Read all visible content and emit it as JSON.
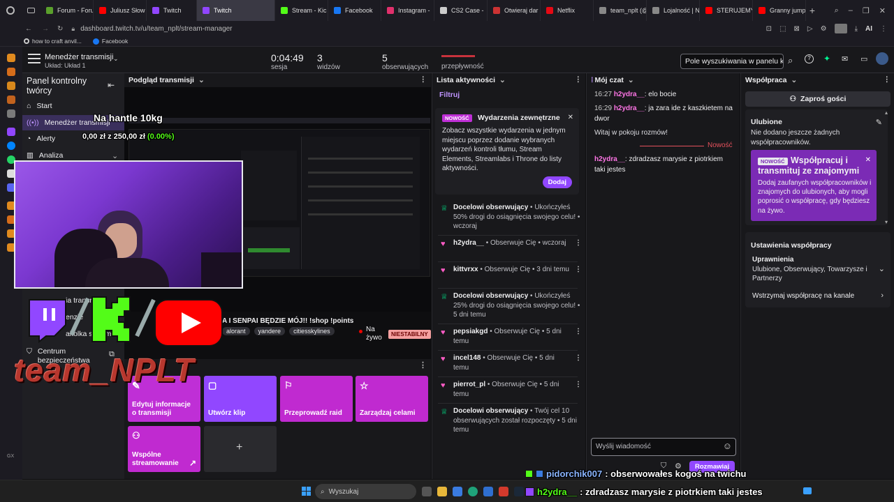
{
  "browser": {
    "tabs": [
      {
        "label": "Forum - Foru",
        "color": "#5aa02c"
      },
      {
        "label": "Juliusz Słow",
        "color": "#ff0000"
      },
      {
        "label": "Twitch",
        "color": "#9146ff"
      },
      {
        "label": "Twitch",
        "color": "#9146ff",
        "active": true
      },
      {
        "label": "Stream - Kic",
        "color": "#53fc18"
      },
      {
        "label": "Facebook",
        "color": "#1877f2"
      },
      {
        "label": "Instagram -",
        "color": "#e1306c"
      },
      {
        "label": "CS2 Case -",
        "color": "#cccccc"
      },
      {
        "label": "Otwieraj dar",
        "color": "#cc3333"
      },
      {
        "label": "Netflix",
        "color": "#e50914"
      },
      {
        "label": "team_nplt (@",
        "color": "#888888"
      },
      {
        "label": "Lojalność | N",
        "color": "#888888"
      },
      {
        "label": "STERUJEMY",
        "color": "#ff0000"
      },
      {
        "label": "Granny jump",
        "color": "#ff0000"
      }
    ],
    "url": "dashboard.twitch.tv/u/team_nplt/stream-manager",
    "url_host_bold": "twitch.tv",
    "bookmarks": [
      "how to craft anvil...",
      "Facebook"
    ],
    "ai_label": "AI"
  },
  "header": {
    "title": "Menedżer transmisji",
    "layout": "Układ: Układ 1",
    "session_value": "0:04:49",
    "session_label": "sesja",
    "viewers_value": "3",
    "viewers_label": "widzów",
    "followers_value": "5",
    "followers_label": "obserwujących",
    "bandwidth_label": "przepływność",
    "search_placeholder": "Pole wyszukiwania w panelu k"
  },
  "left_panel": {
    "title": "Panel kontrolny twórcy",
    "items": [
      "Start",
      "Menedżer transmisji",
      "Alerty",
      "Analiza"
    ],
    "partial_items": [
      "ia transm",
      "enzje",
      "akolka streamer"
    ],
    "safety_center": "Centrum bezpieczeństwa"
  },
  "preview": {
    "title": "Podgląd transmisji",
    "stream_title": "A I SENPAI BĘDZIE MÓJ!! !shop !points",
    "tags": [
      "alorant",
      "yandere",
      "citiesskylines"
    ],
    "live": "Na żywo",
    "unstable": "NIESTABILNY"
  },
  "quick_actions": [
    {
      "label": "Edytuj informacje o transmisji",
      "icon": "edit-icon",
      "color": "#bf2fd6"
    },
    {
      "label": "Utwórz klip",
      "icon": "clip-icon",
      "color": "#9147ff"
    },
    {
      "label": "Przeprowadź raid",
      "icon": "raid-icon",
      "color": "#c02ad0"
    },
    {
      "label": "Zarządzaj celami",
      "icon": "star-icon",
      "color": "#c02ad0"
    },
    {
      "label": "Wspólne streamowanie",
      "icon": "people-icon",
      "color": "#c02ad0"
    }
  ],
  "activity": {
    "title": "Lista aktywności",
    "filter": "Filtruj",
    "notice": {
      "badge": "NOWOŚĆ",
      "title": "Wydarzenia zewnętrzne",
      "body": "Zobacz wszystkie wydarzenia w jednym miejscu poprzez dodanie wybranych wydarzeń kontroli tłumu, Stream Elements, Streamlabs i Throne do listy aktywności.",
      "button": "Dodaj"
    },
    "items": [
      {
        "icon": "trophy",
        "name": "Docelowi obserwujący",
        "text": " • Ukończyłeś 50% drogi do osiągnięcia swojego celu! • wczoraj"
      },
      {
        "icon": "heart",
        "name": "h2ydra__",
        "text": " • Obserwuje Cię • wczoraj"
      },
      {
        "icon": "heart",
        "name": "kittvrxx",
        "text": " • Obserwuje Cię • 3 dni temu"
      },
      {
        "icon": "trophy",
        "name": "Docelowi obserwujący",
        "text": " • Ukończyłeś 25% drogi do osiągnięcia swojego celu! • 5 dni temu"
      },
      {
        "icon": "heart",
        "name": "pepsiakgd",
        "text": " • Obserwuje Cię • 5 dni temu"
      },
      {
        "icon": "heart",
        "name": "incel148",
        "text": " • Obserwuje Cię • 5 dni temu"
      },
      {
        "icon": "heart",
        "name": "pierrot_pl",
        "text": " • Obserwuje Cię • 5 dni temu"
      },
      {
        "icon": "trophy",
        "name": "Docelowi obserwujący",
        "text": " • Twój cel 10 obserwujących został rozpoczęty • 5 dni temu"
      }
    ]
  },
  "chat": {
    "title": "Mój czat",
    "messages": [
      {
        "time": "16:27",
        "user": "h2ydra__",
        "text": ": elo bocie"
      },
      {
        "time": "16:29",
        "user": "h2ydra__",
        "text": ": ja zara ide z kaszkietem na dwor"
      }
    ],
    "welcome": "Witaj w pokoju rozmów!",
    "new_label": "Nowość",
    "new_message": {
      "user": "h2ydra__",
      "text": ": zdradzasz marysie z piotrkiem taki jestes"
    },
    "input_placeholder": "Wyślij wiadomość",
    "send_button": "Rozmawiaj"
  },
  "collab": {
    "title": "Współpraca",
    "invite_button": "Zaproś gości",
    "favorites_title": "Ulubione",
    "favorites_empty": "Nie dodano jeszcze żadnych współpracowników.",
    "promo": {
      "badge": "NOWOŚĆ",
      "title": "Współpracuj i transmituj ze znajomymi",
      "body": "Dodaj zaufanych współpracowników i znajomych do ulubionych, aby mogli poprosić o współpracę, gdy będziesz na żywo."
    },
    "settings_title": "Ustawienia współpracy",
    "permissions_title": "Uprawnienia",
    "permissions_value": "Ulubione, Obserwujący, Towarzysze i Partnerzy",
    "pause_label": "Wstrzymaj współpracę na kanale"
  },
  "overlay": {
    "goal_text": "Na hantle 10kg",
    "donation": "0,00 zł",
    "donation_of": " z ",
    "donation_target": "250,00 zł",
    "donation_pct": " (0.00%)",
    "brand": "team_NPLT",
    "chat_lines": [
      {
        "user": "pidorchik007",
        "text": ": obserwowałes kogoś na twichu"
      },
      {
        "user": "h2ydra__",
        "text": ": zdradzasz marysie z piotrkiem taki jestes"
      }
    ]
  },
  "taskbar": {
    "search_placeholder": "Wyszukaj"
  },
  "colors": {
    "twitch_purple": "#9147ff",
    "magenta": "#bf2fd6",
    "kick_green": "#53fc18",
    "youtube_red": "#ff0000"
  }
}
